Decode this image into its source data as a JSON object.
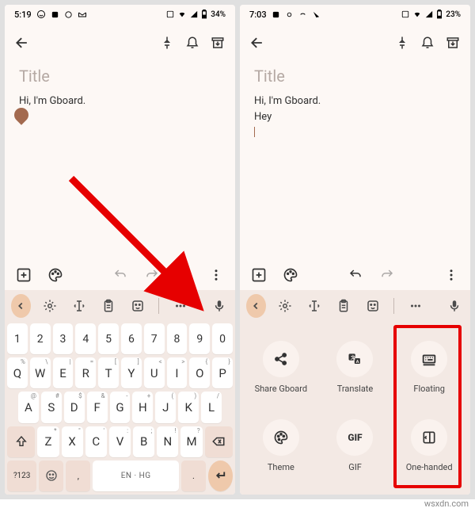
{
  "left": {
    "status": {
      "time": "5:19",
      "battery": "34%"
    },
    "note": {
      "title_placeholder": "Title",
      "body": "Hi, I'm Gboard."
    },
    "keyboard": {
      "space_label": "EN · HG",
      "sym_label": "?123",
      "numbers": [
        "1",
        "2",
        "3",
        "4",
        "5",
        "6",
        "7",
        "8",
        "9",
        "0"
      ],
      "row2": [
        "Q",
        "W",
        "E",
        "R",
        "T",
        "Y",
        "U",
        "I",
        "O",
        "P"
      ],
      "row2_sup": [
        "%",
        "\\",
        "|",
        "=",
        "[",
        "]",
        "<",
        ">",
        "{",
        "}"
      ],
      "row3": [
        "A",
        "S",
        "D",
        "F",
        "G",
        "H",
        "J",
        "K",
        "L"
      ],
      "row3_sup": [
        "@",
        "#",
        "$",
        "&",
        "-",
        "+",
        "(",
        ")",
        "/"
      ],
      "row4": [
        "Z",
        "X",
        "C",
        "V",
        "B",
        "N",
        "M"
      ],
      "row4_sup": [
        "*",
        "\"",
        "'",
        ":",
        ";",
        "!",
        "?"
      ]
    }
  },
  "right": {
    "status": {
      "time": "7:03",
      "battery": "23%"
    },
    "note": {
      "title_placeholder": "Title",
      "body_line1": "Hi, I'm Gboard.",
      "body_line2": "Hey"
    },
    "menu": {
      "items": [
        {
          "label": "Share Gboard"
        },
        {
          "label": "Translate"
        },
        {
          "label": "Floating"
        },
        {
          "label": "Theme"
        },
        {
          "label": "GIF"
        },
        {
          "label": "One-handed"
        }
      ],
      "gif_text": "GIF"
    }
  },
  "watermark": "wsxdn.com"
}
